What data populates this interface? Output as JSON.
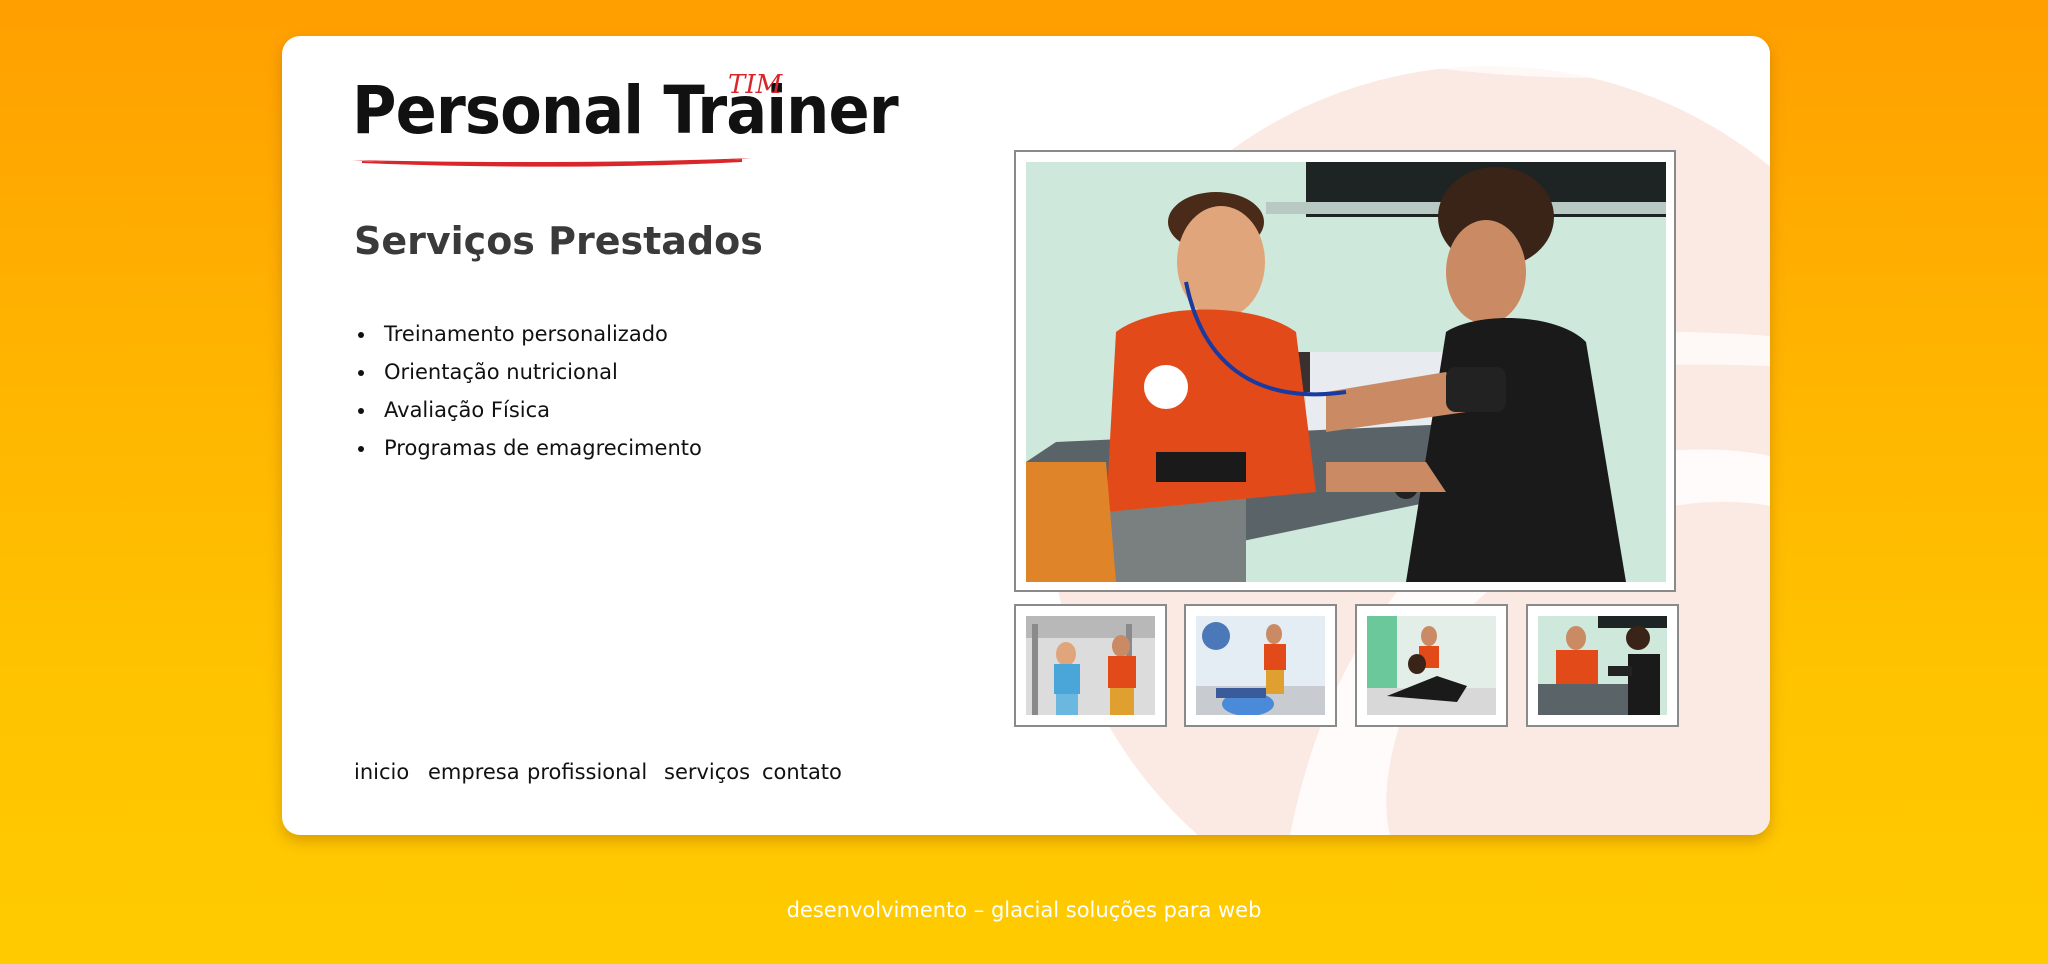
{
  "logo": {
    "brand": "Personal Trainer",
    "tag": "TIM"
  },
  "section": {
    "title": "Serviços Prestados",
    "services": [
      "Treinamento personalizado",
      "Orientação nutricional",
      "Avaliação Física",
      "Programas de emagrecimento"
    ]
  },
  "nav": [
    "inicio",
    "empresa",
    "profissional",
    "serviços",
    "contato"
  ],
  "footer": {
    "credit": "desenvolvimento – glacial soluções para web"
  },
  "colors": {
    "accent_red": "#d9262b",
    "bg_orange": "#ff9f00",
    "bg_yellow": "#ffcb00"
  },
  "images": {
    "main": "photo-trainer-measuring-blood-pressure",
    "thumbs": [
      "photo-gym-machine",
      "photo-floor-exercise-ball",
      "photo-floor-stretch",
      "photo-blood-pressure"
    ]
  }
}
